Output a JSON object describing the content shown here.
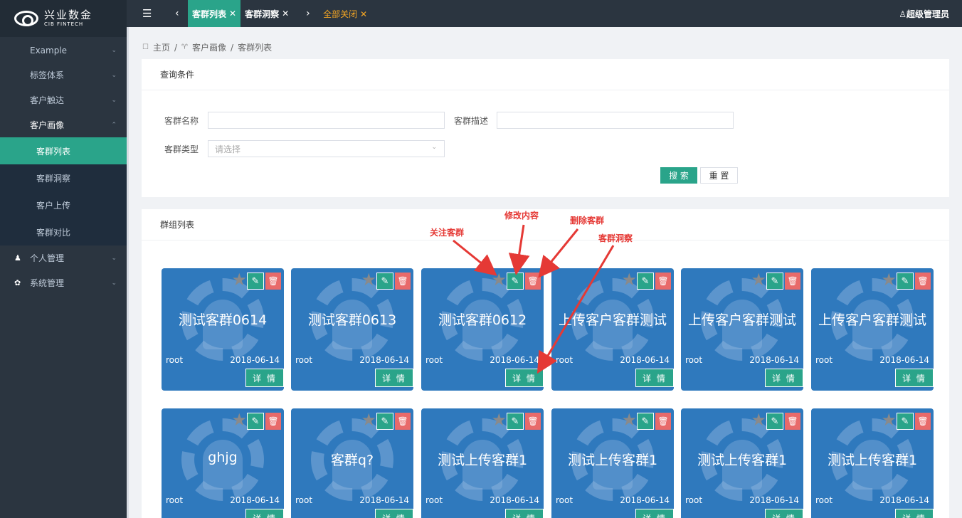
{
  "logo": {
    "cn": "兴业数金",
    "en": "CIB FINTECH"
  },
  "sidebar": {
    "items": [
      {
        "label": "Example"
      },
      {
        "label": "标签体系"
      },
      {
        "label": "客户触达"
      },
      {
        "label": "客户画像"
      },
      {
        "label": "个人管理"
      },
      {
        "label": "系统管理"
      }
    ],
    "subitems": [
      {
        "label": "客群列表"
      },
      {
        "label": "客群洞察"
      },
      {
        "label": "客户上传"
      },
      {
        "label": "客群对比"
      }
    ]
  },
  "topbar": {
    "tabs": [
      {
        "label": "客群列表"
      },
      {
        "label": "客群洞察"
      }
    ],
    "close_all": "全部关闭",
    "user": "超级管理员"
  },
  "breadcrumb": {
    "home": "主页",
    "parent": "客户画像",
    "current": "客群列表"
  },
  "query": {
    "title": "查询条件",
    "name_label": "客群名称",
    "desc_label": "客群描述",
    "type_label": "客群类型",
    "type_placeholder": "请选择",
    "search": "搜 索",
    "reset": "重 置"
  },
  "list": {
    "title": "群组列表",
    "detail_label": "详 情",
    "cards": [
      {
        "name": "测试客群0614",
        "owner": "root",
        "date": "2018-06-14"
      },
      {
        "name": "测试客群0613",
        "owner": "root",
        "date": "2018-06-14"
      },
      {
        "name": "测试客群0612",
        "owner": "root",
        "date": "2018-06-14"
      },
      {
        "name": "上传客户客群测试",
        "owner": "root",
        "date": "2018-06-14"
      },
      {
        "name": "上传客户客群测试",
        "owner": "root",
        "date": "2018-06-14"
      },
      {
        "name": "上传客户客群测试",
        "owner": "root",
        "date": "2018-06-14"
      },
      {
        "name": "ghjg",
        "owner": "root",
        "date": "2018-06-14"
      },
      {
        "name": "客群q?",
        "owner": "root",
        "date": "2018-06-14"
      },
      {
        "name": "测试上传客群1",
        "owner": "root",
        "date": "2018-06-14"
      },
      {
        "name": "测试上传客群1",
        "owner": "root",
        "date": "2018-06-14"
      },
      {
        "name": "测试上传客群1",
        "owner": "root",
        "date": "2018-06-14"
      },
      {
        "name": "测试上传客群1",
        "owner": "root",
        "date": "2018-06-14"
      }
    ]
  },
  "annotations": {
    "follow": "关注客群",
    "edit": "修改内容",
    "delete": "删除客群",
    "insight": "客群洞察"
  },
  "colors": {
    "accent": "#2aa48a",
    "card": "#2f79bd",
    "delete": "#e86a6a",
    "annotation": "#e53935"
  }
}
